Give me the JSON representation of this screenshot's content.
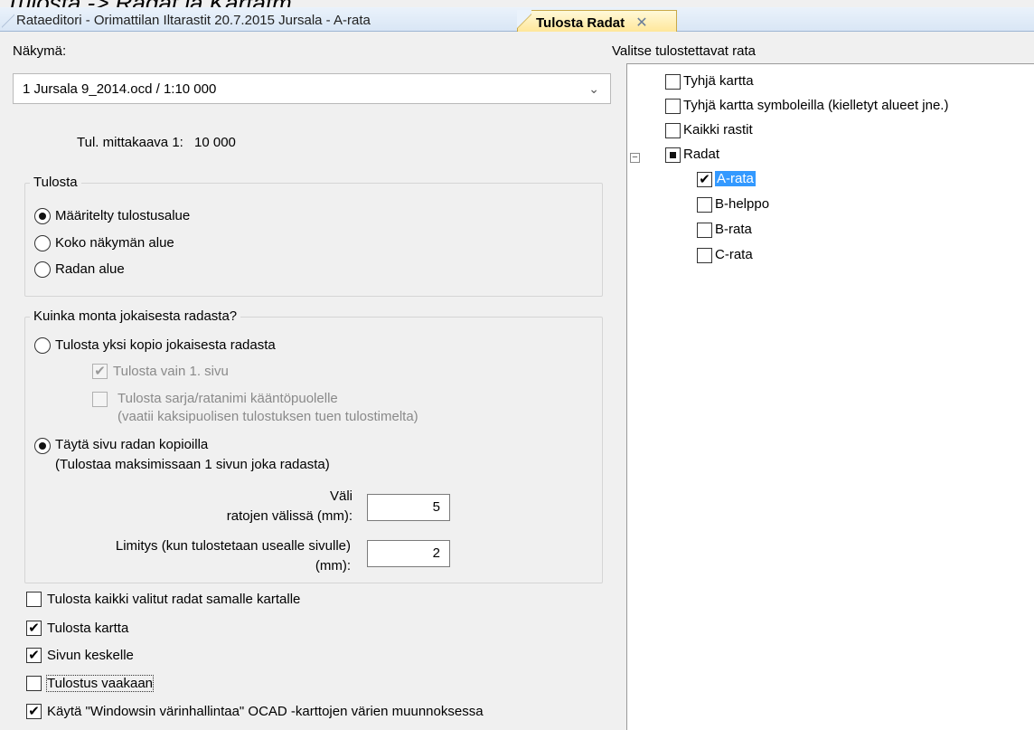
{
  "top_heading": "Tulosta -> Radat ja Kartatm",
  "tabs": [
    {
      "label": "Rataeditori - Orimattilan Iltarastit 20.7.2015 Jursala - A-rata"
    },
    {
      "label": "Tulosta Radat",
      "close": "✕"
    }
  ],
  "view": {
    "label": "Näkymä:",
    "selected": "1 Jursala 9_2014.ocd  / 1:10 000",
    "scale_label": "Tul. mittakaava  1:",
    "scale_value": "10 000"
  },
  "print_group": {
    "title": "Tulosta",
    "options": [
      {
        "label": "Määritelty tulostusalue",
        "selected": true
      },
      {
        "label": "Koko näkymän alue",
        "selected": false
      },
      {
        "label": "Radan alue",
        "selected": false
      }
    ]
  },
  "copies_group": {
    "title": "Kuinka monta jokaisesta radasta?",
    "one_copy_label": "Tulosta yksi kopio jokaisesta radasta",
    "first_page_only_label": "Tulosta vain 1. sivu",
    "name_backside_label_1": "Tulosta sarja/ratanimi kääntöpuolelle",
    "name_backside_label_2": "(vaatii kaksipuolisen tulostuksen tuen tulostimelta)",
    "fill_page_label_1": "Täytä sivu radan kopioilla",
    "fill_page_label_2": "(Tulostaa maksimissaan 1 sivun joka radasta)",
    "gap_label_1": "Väli",
    "gap_label_2": "ratojen välissä (mm):",
    "gap_value": "5",
    "overlap_label_1": "Limitys (kun tulostetaan usealle sivulle)",
    "overlap_label_2": "(mm):",
    "overlap_value": "2"
  },
  "bottom_options": [
    {
      "label": "Tulosta kaikki valitut radat samalle kartalle",
      "checked": false
    },
    {
      "label": "Tulosta kartta",
      "checked": true
    },
    {
      "label": "Sivun keskelle",
      "checked": true
    },
    {
      "label": "Tulostus vaakaan",
      "checked": false
    },
    {
      "label": "Käytä \"Windowsin värinhallintaa\" OCAD -karttojen värien muunnoksessa",
      "checked": true
    }
  ],
  "courses_panel": {
    "title": "Valitse tulostettavat rata",
    "top_items": [
      {
        "label": "Tyhjä kartta"
      },
      {
        "label": "Tyhjä kartta symboleilla (kielletyt alueet jne.)"
      },
      {
        "label": "Kaikki rastit"
      }
    ],
    "group_label": "Radat",
    "expander": "−",
    "courses": [
      {
        "label": "A-rata",
        "checked": true
      },
      {
        "label": "B-helppo",
        "checked": false
      },
      {
        "label": "B-rata",
        "checked": false
      },
      {
        "label": "C-rata",
        "checked": false
      }
    ]
  },
  "check_glyph": "✔",
  "dropdown_arrow": "⌄"
}
